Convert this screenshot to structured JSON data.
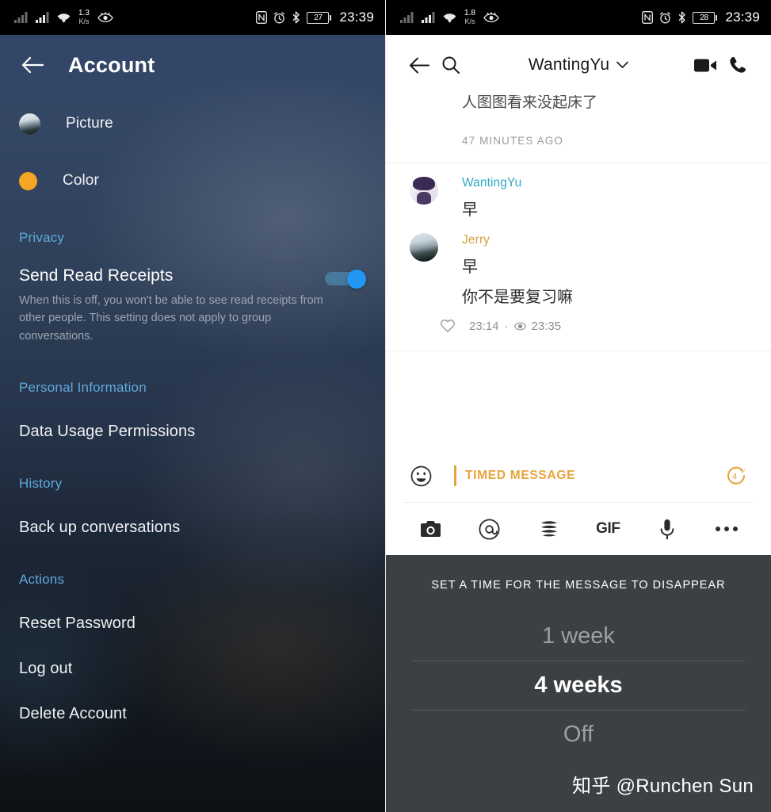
{
  "left": {
    "statusbar": {
      "network_speed_value": "1.3",
      "network_speed_unit": "K/s",
      "battery_percent": "27",
      "clock": "23:39"
    },
    "appbar": {
      "title": "Account"
    },
    "rows": {
      "picture_label": "Picture",
      "color_label": "Color",
      "color_value": "#f5a623"
    },
    "sections": {
      "privacy": "Privacy",
      "personal_information": "Personal Information",
      "history": "History",
      "actions": "Actions"
    },
    "read_receipts": {
      "title": "Send Read Receipts",
      "description": "When this is off, you won't be able to see read receipts from other people. This setting does not apply to group conversations.",
      "enabled": "on"
    },
    "menu": {
      "data_usage": "Data Usage Permissions",
      "back_up": "Back up conversations",
      "reset_password": "Reset Password",
      "log_out": "Log out",
      "delete_account": "Delete Account"
    }
  },
  "right": {
    "statusbar": {
      "network_speed_value": "1.8",
      "network_speed_unit": "K/s",
      "battery_percent": "28",
      "clock": "23:39"
    },
    "header": {
      "contact_name": "WantingYu"
    },
    "conversation": {
      "truncated_message": "人图图看来没起床了",
      "time_separator": "47 MINUTES AGO",
      "messages": [
        {
          "sender": "WantingYu",
          "sender_color": "#2fa8c7",
          "text": "早"
        },
        {
          "sender": "Jerry",
          "sender_color": "#d6a23c",
          "text": "早",
          "text2": "你不是要复习嘛",
          "sent_time": "23:14",
          "read_time": "23:35"
        }
      ]
    },
    "composer": {
      "placeholder": "TIMED MESSAGE",
      "timer_value": "4",
      "timer_unit": "w",
      "accent_color": "#e8a33d",
      "gif_label": "GIF"
    },
    "picker": {
      "title": "SET A TIME FOR THE MESSAGE TO DISAPPEAR",
      "options": [
        {
          "label": "1 week",
          "selected": false
        },
        {
          "label": "4 weeks",
          "selected": true
        },
        {
          "label": "Off",
          "selected": false
        }
      ]
    },
    "watermark": "知乎 @Runchen Sun"
  }
}
